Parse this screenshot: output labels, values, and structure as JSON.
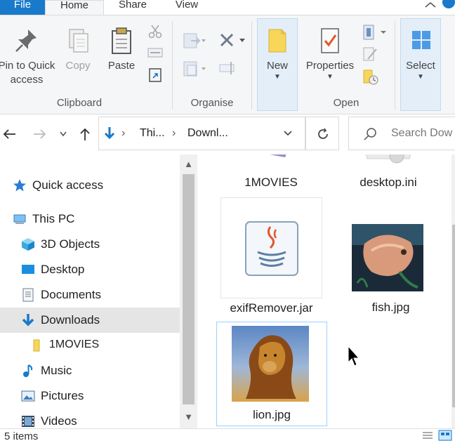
{
  "ribbon_tabs": [
    "File",
    "Home",
    "Share",
    "View"
  ],
  "ribbon": {
    "pin_line1": "Pin to Quick",
    "pin_line2": "access",
    "copy": "Copy",
    "paste": "Paste",
    "clipboard_group": "Clipboard",
    "organise_group": "Organise",
    "new": "New",
    "properties": "Properties",
    "open_group": "Open",
    "select": "Select"
  },
  "address": {
    "crumb1": "Thi...",
    "crumb2": "Downl...",
    "search_placeholder": "Search Dow"
  },
  "nav": {
    "quick_access": "Quick access",
    "this_pc": "This PC",
    "objects_3d": "3D Objects",
    "desktop": "Desktop",
    "documents": "Documents",
    "downloads": "Downloads",
    "movies_folder": "1MOVIES",
    "music": "Music",
    "pictures": "Pictures",
    "videos": "Videos"
  },
  "files": {
    "f1": "1MOVIES",
    "f2": "desktop.ini",
    "f3": "exifRemover.jar",
    "f4": "fish.jpg",
    "f5": "lion.jpg"
  },
  "status": {
    "count": "5 items"
  },
  "colors": {
    "accent": "#1979ca",
    "selection": "#cce8ff",
    "nav_selected": "#e5e5e5"
  },
  "icons": [
    "pin-icon",
    "copy-icon",
    "paste-icon",
    "cut-icon",
    "new-folder-icon",
    "properties-icon",
    "select-all-icon",
    "back-icon",
    "forward-icon",
    "up-icon",
    "refresh-icon",
    "search-icon",
    "star-icon",
    "pc-icon",
    "cube-icon",
    "desktop-icon",
    "documents-icon",
    "downloads-icon",
    "folder-icon",
    "music-icon",
    "pictures-icon",
    "videos-icon"
  ]
}
